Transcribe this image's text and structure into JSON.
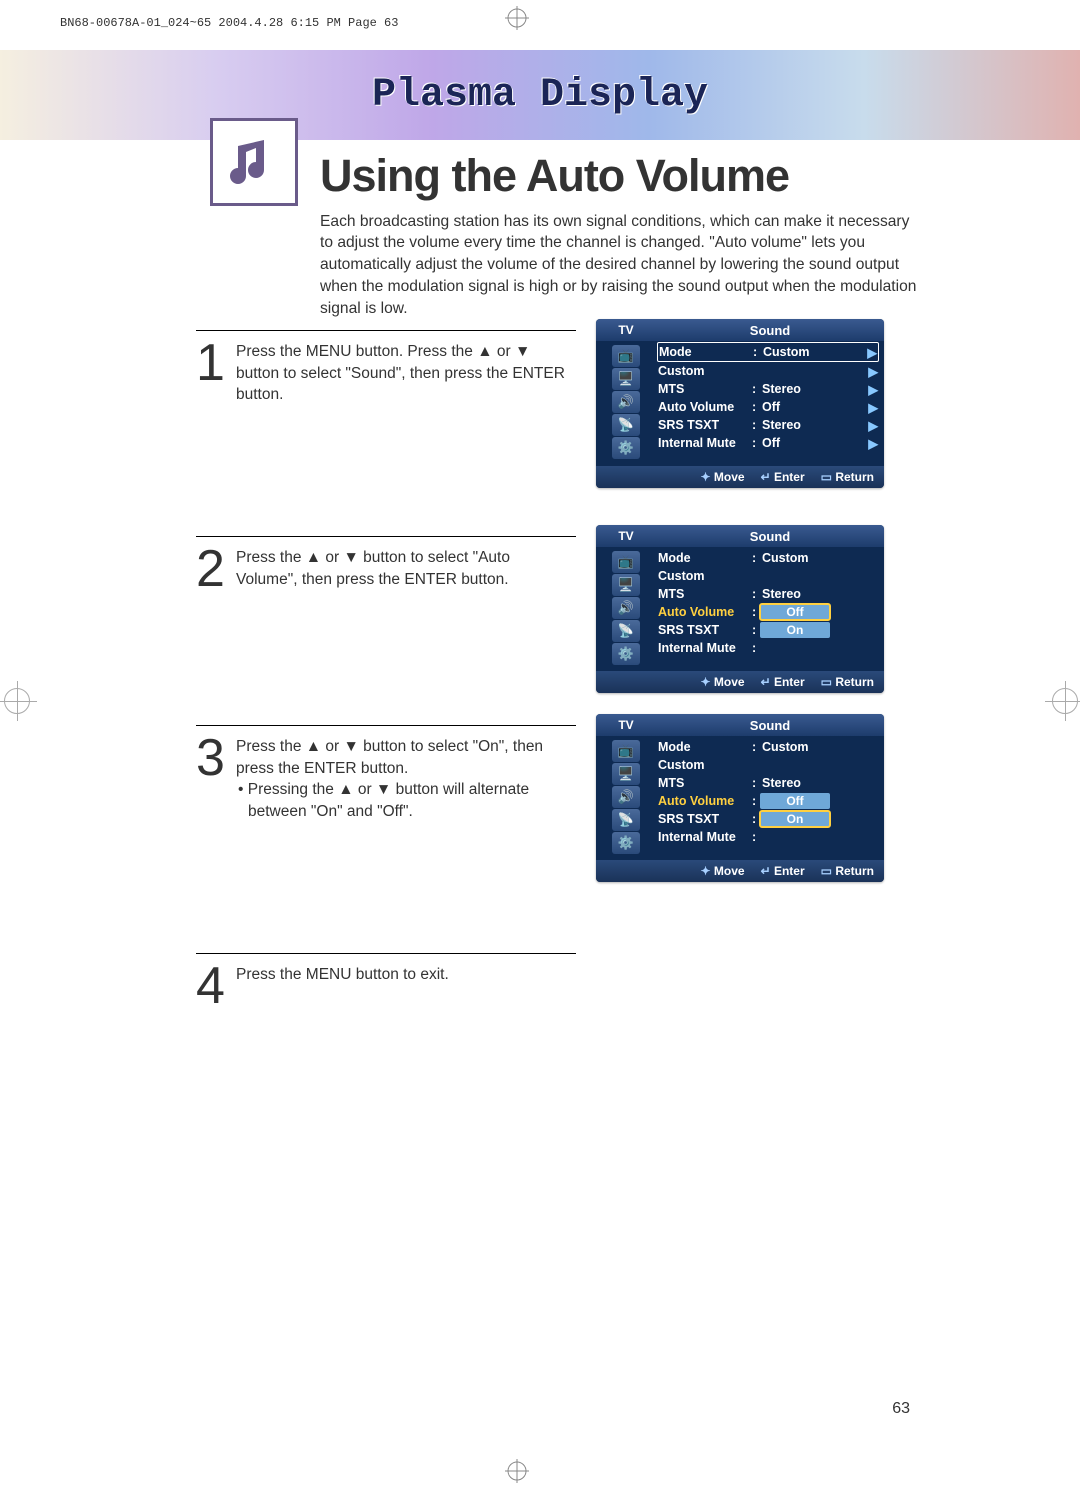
{
  "headerLine": "BN68-00678A-01_024~65  2004.4.28  6:15 PM  Page 63",
  "bannerTitle": "Plasma Display",
  "pageTitle": "Using the Auto Volume",
  "intro": "Each broadcasting station has its own signal conditions, which can make it necessary to adjust the volume every time the channel is changed. \"Auto volume\" lets you automatically adjust the volume of the desired channel by lowering the sound output when the modulation signal is high or by raising the sound output when the modulation signal is low.",
  "steps": {
    "s1": {
      "num": "1",
      "text": "Press the MENU button. Press the ▲ or ▼ button to select \"Sound\", then press the ENTER button."
    },
    "s2": {
      "num": "2",
      "text": "Press the ▲ or ▼ button to select \"Auto Volume\", then press the ENTER button."
    },
    "s3": {
      "num": "3",
      "text": "Press the ▲ or ▼ button to select \"On\", then press the ENTER button.",
      "bullet": "• Pressing the ▲ or ▼ button will alternate between \"On\" and \"Off\"."
    },
    "s4": {
      "num": "4",
      "text": "Press the MENU button to exit."
    }
  },
  "osd": {
    "tv": "TV",
    "title": "Sound",
    "labels": {
      "mode": "Mode",
      "custom": "Custom",
      "mts": "MTS",
      "auto": "Auto Volume",
      "srs": "SRS TSXT",
      "mute": "Internal Mute"
    },
    "vals": {
      "custom": "Custom",
      "stereo": "Stereo",
      "off": "Off",
      "on": "On"
    },
    "foot": {
      "move": "Move",
      "enter": "Enter",
      "return": "Return"
    }
  },
  "pageNumber": "63"
}
